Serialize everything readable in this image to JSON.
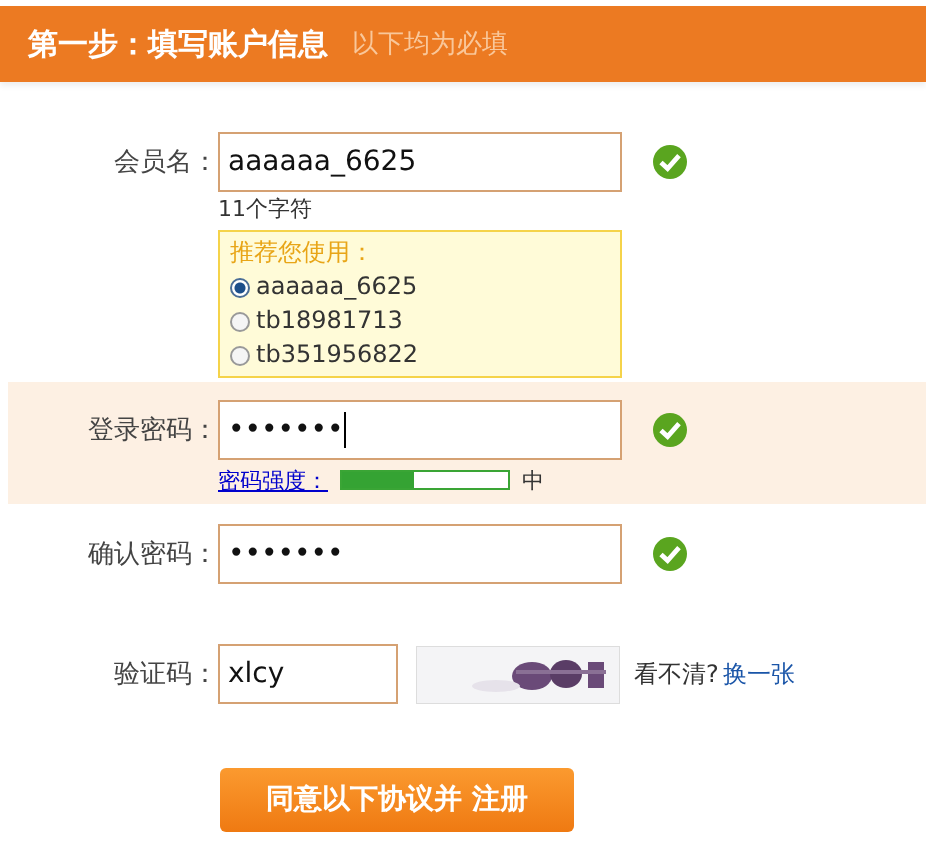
{
  "header": {
    "title": "第一步：填写账户信息",
    "subtitle": "以下均为必填"
  },
  "username": {
    "label": "会员名：",
    "value": "aaaaaa_6625",
    "valid": true,
    "hint": "11个字符",
    "suggestions": {
      "title": "推荐您使用：",
      "options": [
        {
          "label": "aaaaaa_6625",
          "selected": true
        },
        {
          "label": "tb18981713",
          "selected": false
        },
        {
          "label": "tb351956822",
          "selected": false
        }
      ]
    }
  },
  "password": {
    "label": "登录密码：",
    "value": "•••••••",
    "focused": true,
    "valid": true,
    "strength_label": "密码强度：",
    "strength": {
      "level": 0.43
    },
    "strength_text": "中"
  },
  "confirm": {
    "label": "确认密码：",
    "value": "•••••••",
    "focused": false,
    "valid": true
  },
  "captcha": {
    "label": "验证码：",
    "value": "xlcy",
    "unclear": "看不清?",
    "refresh": "换一张"
  },
  "submit": "同意以下协议并 注册"
}
